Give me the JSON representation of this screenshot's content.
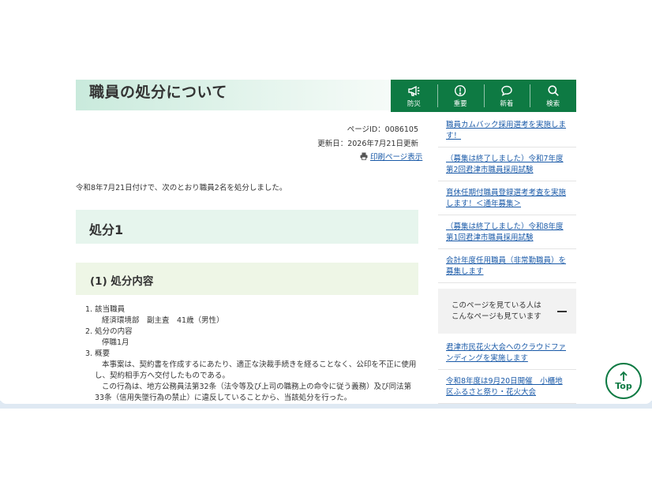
{
  "page": {
    "title": "職員の処分について",
    "page_id": "ページID：0086105",
    "updated": "更新日：2026年7月21日更新",
    "print_label": "印刷ページ表示",
    "intro": "令和8年7月21日付けで、次のとおり職員2名を処分しました。",
    "h2": "処分1",
    "h3": "(1) 処分内容"
  },
  "toolbar": {
    "items": [
      {
        "label": "防災",
        "icon": "megaphone-icon"
      },
      {
        "label": "重要",
        "icon": "alert-icon"
      },
      {
        "label": "新着",
        "icon": "speech-bubble-icon"
      },
      {
        "label": "検索",
        "icon": "search-icon"
      }
    ]
  },
  "content": {
    "item1_label": "1. 該当職員",
    "item1_value": "経済環境部　副主査　41歳（男性）",
    "item2_label": "2. 処分の内容",
    "item2_value": "停職1月",
    "item3_label": "3. 概要",
    "item3_para1": "本事案は、契約書を作成するにあたり、適正な決裁手続きを経ることなく、公印を不正に使用し、契約相手方へ交付したものである。",
    "item3_para2": "この行為は、地方公務員法第32条（法令等及び上司の職務上の命令に従う義務）及び同法第33条（信用失墜行為の禁止）に違反していることから、当該処分を行った。"
  },
  "sidebar": {
    "links": [
      "職員カムバック採用選考を実施します！",
      "（募集は終了しました）令和7年度第2回君津市職員採用試験",
      "育休任期付職員登録選考考査を実施します！＜通年募集＞",
      "（募集は終了しました）令和8年度第1回君津市職員採用試験",
      "会計年度任用職員（非常勤職員）を募集します"
    ],
    "recommend_line1": "このページを見ている人は",
    "recommend_line2": "こんなページも見ています",
    "links2": [
      "君津市民花火大会へのクラウドファンディングを実施します",
      "令和8年度は9月20日開催　小櫃地区ふるさと祭り・花火大会"
    ]
  },
  "top_button": "Top",
  "colors": {
    "brand_green": "#0e7a43",
    "link_blue": "#1a5aa8",
    "heading_bg": "#e6f5ed"
  }
}
